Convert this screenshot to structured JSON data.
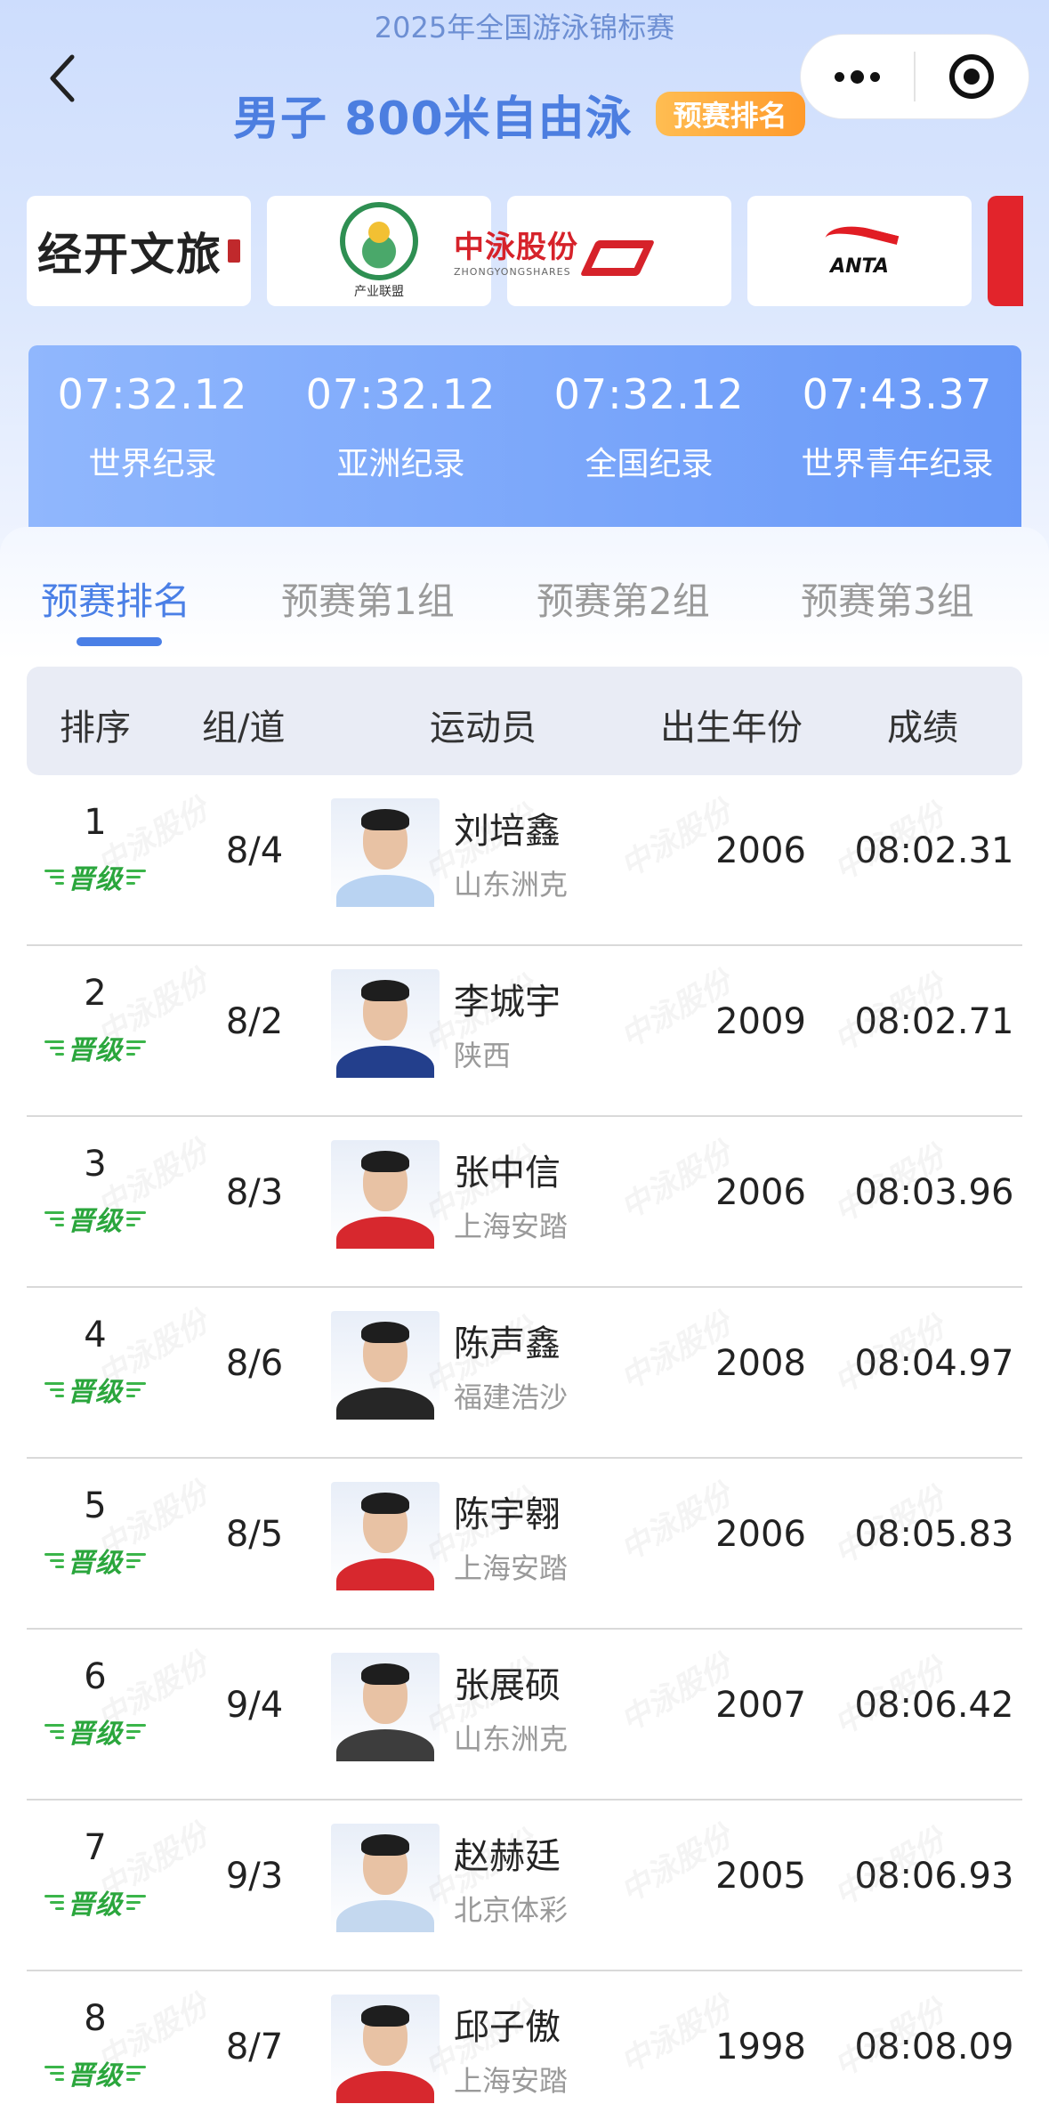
{
  "header": {
    "subtitle": "2025年全国游泳锦标赛",
    "title": "男子 800米自由泳",
    "badge": "预赛排名"
  },
  "icons": {
    "back": "chevron-left-icon",
    "more": "more-dots-icon",
    "close": "target-close-icon"
  },
  "sponsors": {
    "s1": "经开文旅",
    "s2_caption": "产业联盟",
    "s3_cn": "中泳股份",
    "s3_en": "ZHONGYONGSHARES",
    "s4": "ANTA"
  },
  "records": [
    {
      "time": "07:32.12",
      "label": "世界纪录"
    },
    {
      "time": "07:32.12",
      "label": "亚洲纪录"
    },
    {
      "time": "07:32.12",
      "label": "全国纪录"
    },
    {
      "time": "07:43.37",
      "label": "世界青年纪录"
    }
  ],
  "tabs": [
    "预赛排名",
    "预赛第1组",
    "预赛第2组",
    "预赛第3组"
  ],
  "active_tab": 0,
  "table": {
    "headers": [
      "排序",
      "组/道",
      "运动员",
      "出生年份",
      "成绩"
    ],
    "qualified_label": "晋级",
    "rows": [
      {
        "rank": "1",
        "lane": "8/4",
        "name": "刘培鑫",
        "team": "山东洲克",
        "year": "2006",
        "result": "08:02.31"
      },
      {
        "rank": "2",
        "lane": "8/2",
        "name": "李城宇",
        "team": "陕西",
        "year": "2009",
        "result": "08:02.71"
      },
      {
        "rank": "3",
        "lane": "8/3",
        "name": "张中信",
        "team": "上海安踏",
        "year": "2006",
        "result": "08:03.96"
      },
      {
        "rank": "4",
        "lane": "8/6",
        "name": "陈声鑫",
        "team": "福建浩沙",
        "year": "2008",
        "result": "08:04.97"
      },
      {
        "rank": "5",
        "lane": "8/5",
        "name": "陈宇翱",
        "team": "上海安踏",
        "year": "2006",
        "result": "08:05.83"
      },
      {
        "rank": "6",
        "lane": "9/4",
        "name": "张展硕",
        "team": "山东洲克",
        "year": "2007",
        "result": "08:06.42"
      },
      {
        "rank": "7",
        "lane": "9/3",
        "name": "赵赫廷",
        "team": "北京体彩",
        "year": "2005",
        "result": "08:06.93"
      },
      {
        "rank": "8",
        "lane": "8/7",
        "name": "邱子傲",
        "team": "上海安踏",
        "year": "1998",
        "result": "08:08.09"
      }
    ]
  },
  "watermark": "中泳股份",
  "colors": {
    "accent": "#4a7fe6",
    "badge": "#ff9a2b",
    "qualified": "#2aa63c",
    "records_bg": "#6999f8"
  }
}
